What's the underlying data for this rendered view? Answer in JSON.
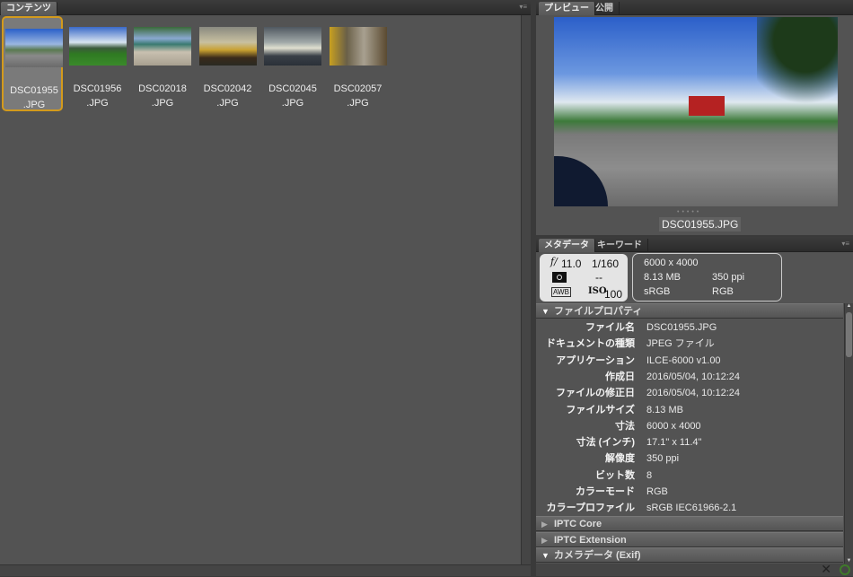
{
  "content_panel": {
    "tab": "コンテンツ",
    "items": [
      {
        "name1": "DSC01955",
        "name2": ".JPG",
        "selected": true
      },
      {
        "name1": "DSC01956",
        "name2": ".JPG"
      },
      {
        "name1": "DSC02018",
        "name2": ".JPG"
      },
      {
        "name1": "DSC02042",
        "name2": ".JPG"
      },
      {
        "name1": "DSC02045",
        "name2": ".JPG"
      },
      {
        "name1": "DSC02057",
        "name2": ".JPG"
      }
    ]
  },
  "preview_panel": {
    "tabs": [
      "プレビュー",
      "公開"
    ],
    "caption": "DSC01955.JPG"
  },
  "metadata_panel": {
    "tabs": [
      "メタデータ",
      "キーワード"
    ],
    "camera": {
      "aperture": "11.0",
      "shutter": "1/160",
      "metering": "--",
      "wb": "AWB",
      "iso": "100"
    },
    "summary": {
      "dimensions": "6000 x 4000",
      "size": "8.13 MB",
      "resolution": "350 ppi",
      "profile": "sRGB",
      "mode": "RGB"
    },
    "section_file": "ファイルプロパティ",
    "props": [
      {
        "k": "ファイル名",
        "v": "DSC01955.JPG"
      },
      {
        "k": "ドキュメントの種類",
        "v": "JPEG ファイル"
      },
      {
        "k": "アプリケーション",
        "v": "ILCE-6000 v1.00"
      },
      {
        "k": "作成日",
        "v": "2016/05/04, 10:12:24"
      },
      {
        "k": "ファイルの修正日",
        "v": "2016/05/04, 10:12:24"
      },
      {
        "k": "ファイルサイズ",
        "v": "8.13 MB"
      },
      {
        "k": "寸法",
        "v": "6000 x 4000"
      },
      {
        "k": "寸法 (インチ)",
        "v": "17.1\" x 11.4\""
      },
      {
        "k": "解像度",
        "v": "350 ppi"
      },
      {
        "k": "ビット数",
        "v": "8"
      },
      {
        "k": "カラーモード",
        "v": "RGB"
      },
      {
        "k": "カラープロファイル",
        "v": "sRGB IEC61966-2.1"
      }
    ],
    "sections": [
      "IPTC Core",
      "IPTC Extension",
      "カメラデータ (Exif)"
    ]
  },
  "colors": {
    "selection": "#d39a1c",
    "panel": "#535353"
  }
}
